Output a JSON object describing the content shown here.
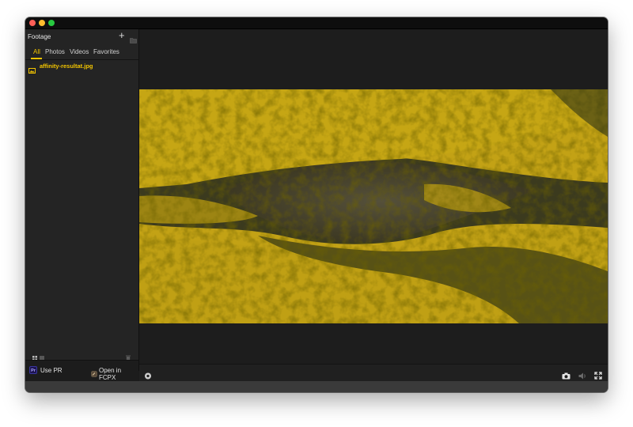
{
  "sidebar": {
    "title": "Footage",
    "add_icon": "plus-icon",
    "folder_icon": "folder-icon",
    "tabs": [
      {
        "label": "All",
        "active": true
      },
      {
        "label": "Photos",
        "active": false
      },
      {
        "label": "Videos",
        "active": false
      },
      {
        "label": "Favorites",
        "active": false
      }
    ],
    "files": [
      {
        "name": "affinity-resultat.jpg",
        "icon": "image-icon",
        "selected": true
      }
    ],
    "footer": {
      "grid_icon": "grid-view-icon",
      "list_icon": "list-view-icon",
      "trash_icon": "trash-icon",
      "pr_badge": "Pr",
      "use_pr_label": "Use PR",
      "fcpx_icon": "final-cut-icon",
      "open_fcpx_label": "Open in FCPX"
    }
  },
  "player": {
    "left_icon": "eye-icon",
    "camera_icon": "camera-icon",
    "volume_icon": "volume-icon",
    "fullscreen_icon": "fullscreen-icon"
  },
  "colors": {
    "accent": "#f2c400",
    "sidebar_bg": "#242424",
    "main_bg": "#1d1d1d"
  }
}
